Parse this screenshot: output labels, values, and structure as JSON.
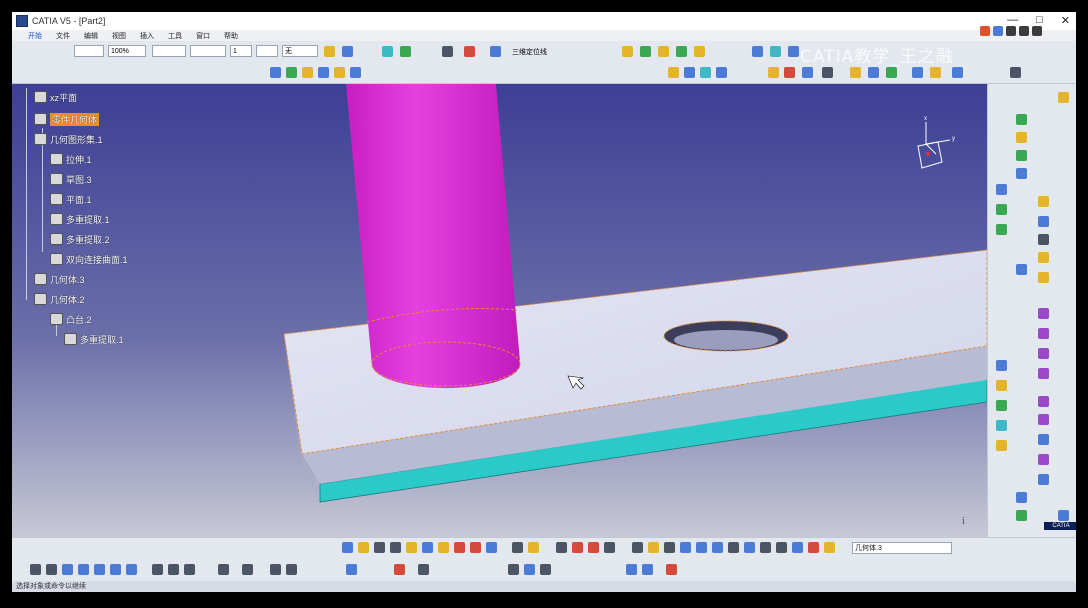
{
  "window": {
    "title": "CATIA V5 - [Part2]",
    "controls": [
      "—",
      "□",
      "✕"
    ]
  },
  "menubar": {
    "items": [
      "开始",
      "文件",
      "编辑",
      "视图",
      "插入",
      "工具",
      "窗口",
      "帮助"
    ]
  },
  "toolbar": {
    "zoom_value": "100%",
    "thickness_value": "1",
    "no_label": "无",
    "tool_label": "三维定位线"
  },
  "watermark": {
    "text": "CATIA教学_王之融"
  },
  "tree": {
    "nodes": [
      {
        "label": "xz平面",
        "selected": false
      },
      {
        "label": "零件几何体",
        "selected": true
      },
      {
        "label": "几何图形集.1",
        "selected": false
      },
      {
        "label": "拉伸.1",
        "selected": false
      },
      {
        "label": "草图.3",
        "selected": false
      },
      {
        "label": "平面.1",
        "selected": false
      },
      {
        "label": "多重提取.1",
        "selected": false
      },
      {
        "label": "多重提取.2",
        "selected": false
      },
      {
        "label": "双向连接曲面.1",
        "selected": false
      },
      {
        "label": "几何体.3",
        "selected": false
      },
      {
        "label": "几何体.2",
        "selected": false
      },
      {
        "label": "凸台.2",
        "selected": false
      },
      {
        "label": "多重提取.1",
        "selected": false
      }
    ]
  },
  "compass": {
    "x_label": "x",
    "y_label": "y"
  },
  "command": {
    "value": "几何体.3"
  },
  "statusbar": {
    "text": "选择对象或命令以继续"
  },
  "colors": {
    "cylinder": "#d624cf",
    "plate_top": "#d8dbf0",
    "plate_edge": "#2cc9c9",
    "background_top": "#3c3f95",
    "background_bottom": "#c9cad7",
    "selection": "#f08b2c"
  },
  "catia_logo": "CATIA"
}
